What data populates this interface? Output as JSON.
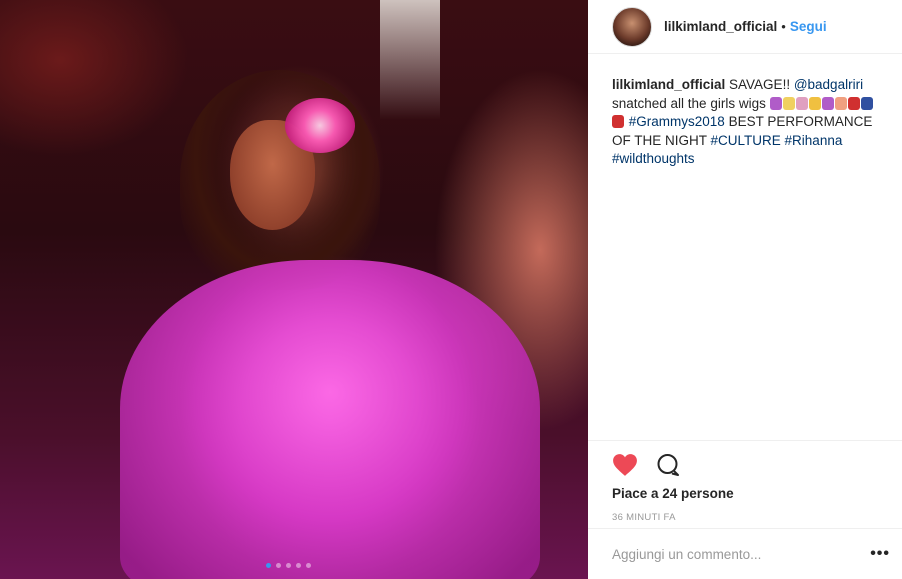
{
  "post": {
    "image_alt_icon": "photo",
    "carousel": {
      "count": 5,
      "active_index": 0,
      "active_color": "#3897f0"
    }
  },
  "header": {
    "username": "lilkimland_official",
    "separator": "•",
    "follow_label": "Segui"
  },
  "caption": {
    "username": "lilkimland_official",
    "text_1": "SAVAGE!! ",
    "mention": "@badgalriri",
    "text_2": " snatched all the girls wigs ",
    "emoji_row_1": [
      "#b05cc8",
      "#f0d060",
      "#e0a0c0",
      "#f0c040",
      "#b05cc8",
      "#f0a080",
      "#d03030",
      "#3050a0"
    ],
    "emoji_row_2": [
      "#d03030"
    ],
    "hashtag_1": "#Grammys2018",
    "text_3": " BEST PERFORMANCE OF THE NIGHT ",
    "hashtag_2": "#CULTURE",
    "hashtag_3": "#Rihanna",
    "hashtag_4": "#wildthoughts"
  },
  "actions": {
    "like_icon": "heart-icon",
    "like_color": "#ed4956",
    "comment_icon": "comment-icon",
    "likes_text": "Piace a 24 persone",
    "timestamp": "36 MINUTI FA"
  },
  "comment_box": {
    "placeholder": "Aggiungi un commento...",
    "more_label": "•••"
  }
}
